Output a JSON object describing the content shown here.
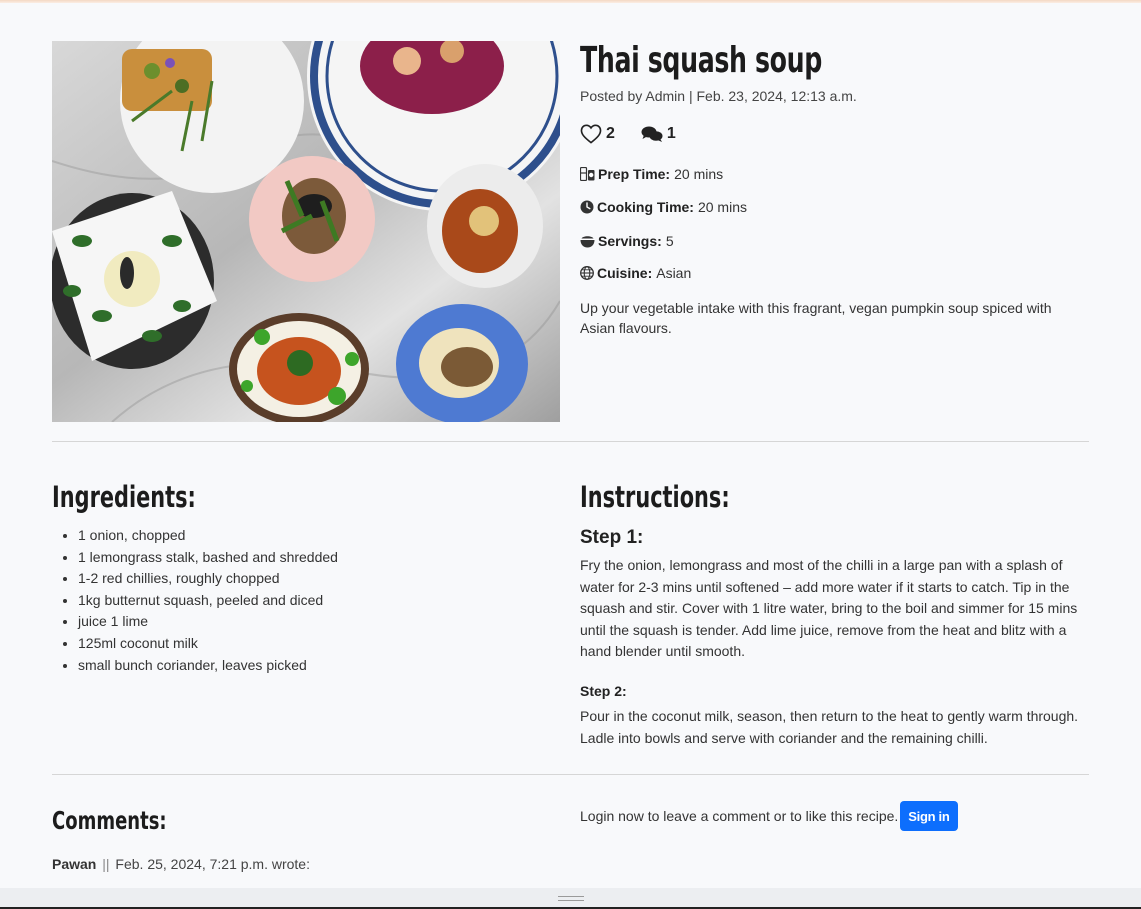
{
  "recipe": {
    "title": "Thai squash soup",
    "meta": "Posted by Admin | Feb. 23, 2024, 12:13 a.m.",
    "likes": "2",
    "comments_count": "1",
    "prep_label": "Prep Time:",
    "prep_value": "20 mins",
    "cook_label": "Cooking Time:",
    "cook_value": "20 mins",
    "servings_label": "Servings:",
    "servings_value": "5",
    "cuisine_label": "Cuisine:",
    "cuisine_value": "Asian",
    "description": "Up your vegetable intake with this fragrant, vegan pumpkin soup spiced with Asian flavours."
  },
  "ingredients": {
    "heading": "Ingredients:",
    "items": [
      "1 onion, chopped",
      "1 lemongrass stalk, bashed and shredded",
      "1-2 red chillies, roughly chopped",
      "1kg butternut squash, peeled and diced",
      "juice 1 lime",
      "125ml coconut milk",
      "small bunch coriander, leaves picked"
    ]
  },
  "instructions": {
    "heading": "Instructions:",
    "steps": [
      {
        "title": "Step 1:",
        "text": "Fry the onion, lemongrass and most of the chilli in a large pan with a splash of water for 2-3 mins until softened – add more water if it starts to catch. Tip in the squash and stir. Cover with 1 litre water, bring to the boil and simmer for 15 mins until the squash is tender. Add lime juice, remove from the heat and blitz with a hand blender until smooth."
      },
      {
        "title": "Step 2:",
        "text": "Pour in the coconut milk, season, then return to the heat to gently warm through. Ladle into bowls and serve with coriander and the remaining chilli."
      }
    ]
  },
  "comments": {
    "heading": "Comments:",
    "login_prompt": "Login now to leave a comment or to like this recipe.",
    "signin_label": "Sign in",
    "entries": [
      {
        "author": "Pawan",
        "separator": "||",
        "date_text": "Feb. 25, 2024, 7:21 p.m. wrote:"
      }
    ]
  },
  "icons": {
    "like": "heart-outline-icon",
    "comment": "comments-icon",
    "prep": "kitchen-icon",
    "cook": "clock-icon",
    "servings": "bowl-icon",
    "cuisine": "globe-icon"
  },
  "colors": {
    "background": "#f8f9fb",
    "accent": "#0d6efd",
    "heading": "#1c1c1c",
    "rule": "#d6d6d6"
  }
}
